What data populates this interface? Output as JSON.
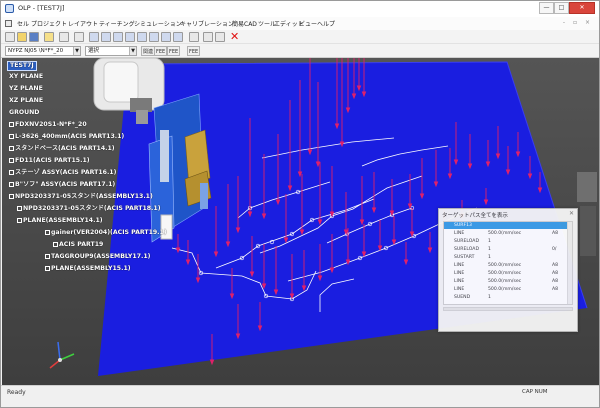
{
  "window": {
    "title": "OLP - [TEST7J]"
  },
  "controls": {
    "minimize": "—",
    "maximize": "□",
    "close": "✕"
  },
  "menu": {
    "items": [
      "セル",
      "プロジェクト",
      "レイアウト",
      "ティーチング",
      "シミュレーション",
      "キャリブレーション",
      "簡易CAD",
      "ツール",
      "エディット",
      "ビュー",
      "ヘルプ"
    ],
    "mdi": "- ▫ ×"
  },
  "toolbar2": {
    "combo1": "NYPZ NJ05 \\N*F*_20",
    "combo2": "選択",
    "btn1": "関連",
    "btn2": "FEE",
    "btn3": "FEE",
    "btn4": "FEE"
  },
  "tree": {
    "nodes": [
      "TEST7J",
      "XY PLANE",
      "YZ PLANE",
      "XZ PLANE",
      "GROUND",
      "FDXNV20S1-N*F*_20",
      "L-3626_400mm(ACIS PART13.1)",
      "スタンドベース(ACIS PART14.1)",
      "FD11(ACIS PART15.1)",
      "ステーゾ ASSY(ACIS PART16.1)",
      "B\"ソフ\" ASSY(ACIS PART17.1)",
      "NPD3203371-05スタンド(ASSEMBLY13.1)",
      "NPD3203371-05スタンド(ACIS PART18.1)",
      "PLANE(ASSEMBLY14.1)",
      "gainer(VER2004)(ACIS PART19.1)",
      "ACIS PART19",
      "TAGGROUP9(ASSEMBLY17.1)",
      "PLANE(ASSEMBLY15.1)"
    ]
  },
  "panel": {
    "title": "ターゲットパス全てを表示",
    "rows": [
      {
        "c1": "SURF13",
        "c2": "",
        "c3": "",
        "selected": true
      },
      {
        "c1": "LINE",
        "c2": "500.0(mm/sec",
        "c3": "A8",
        "selected": false
      },
      {
        "c1": "SURELOAD",
        "c2": "1",
        "c3": "",
        "selected": false
      },
      {
        "c1": "SURELOAD",
        "c2": "1",
        "c3": "0/",
        "selected": false
      },
      {
        "c1": "SUSTART",
        "c2": "1",
        "c3": "",
        "selected": false
      },
      {
        "c1": "LINE",
        "c2": "500.0(mm/sec",
        "c3": "A8",
        "selected": false
      },
      {
        "c1": "LINE",
        "c2": "500.0(mm/sec",
        "c3": "A8",
        "selected": false
      },
      {
        "c1": "LINE",
        "c2": "500.0(mm/sec",
        "c3": "A8",
        "selected": false
      },
      {
        "c1": "LINE",
        "c2": "500.0(mm/sec",
        "c3": "A8",
        "selected": false
      },
      {
        "c1": "SUEND",
        "c2": "1",
        "c3": "",
        "selected": false
      }
    ]
  },
  "status": {
    "left": "Ready",
    "right": "CAP  NUM"
  },
  "colors": {
    "plane": "#1a1ee0",
    "background": "#4b4b4b",
    "paths": "#ffffff",
    "targets": "#e0206a",
    "selection": "#2b5ec0"
  }
}
